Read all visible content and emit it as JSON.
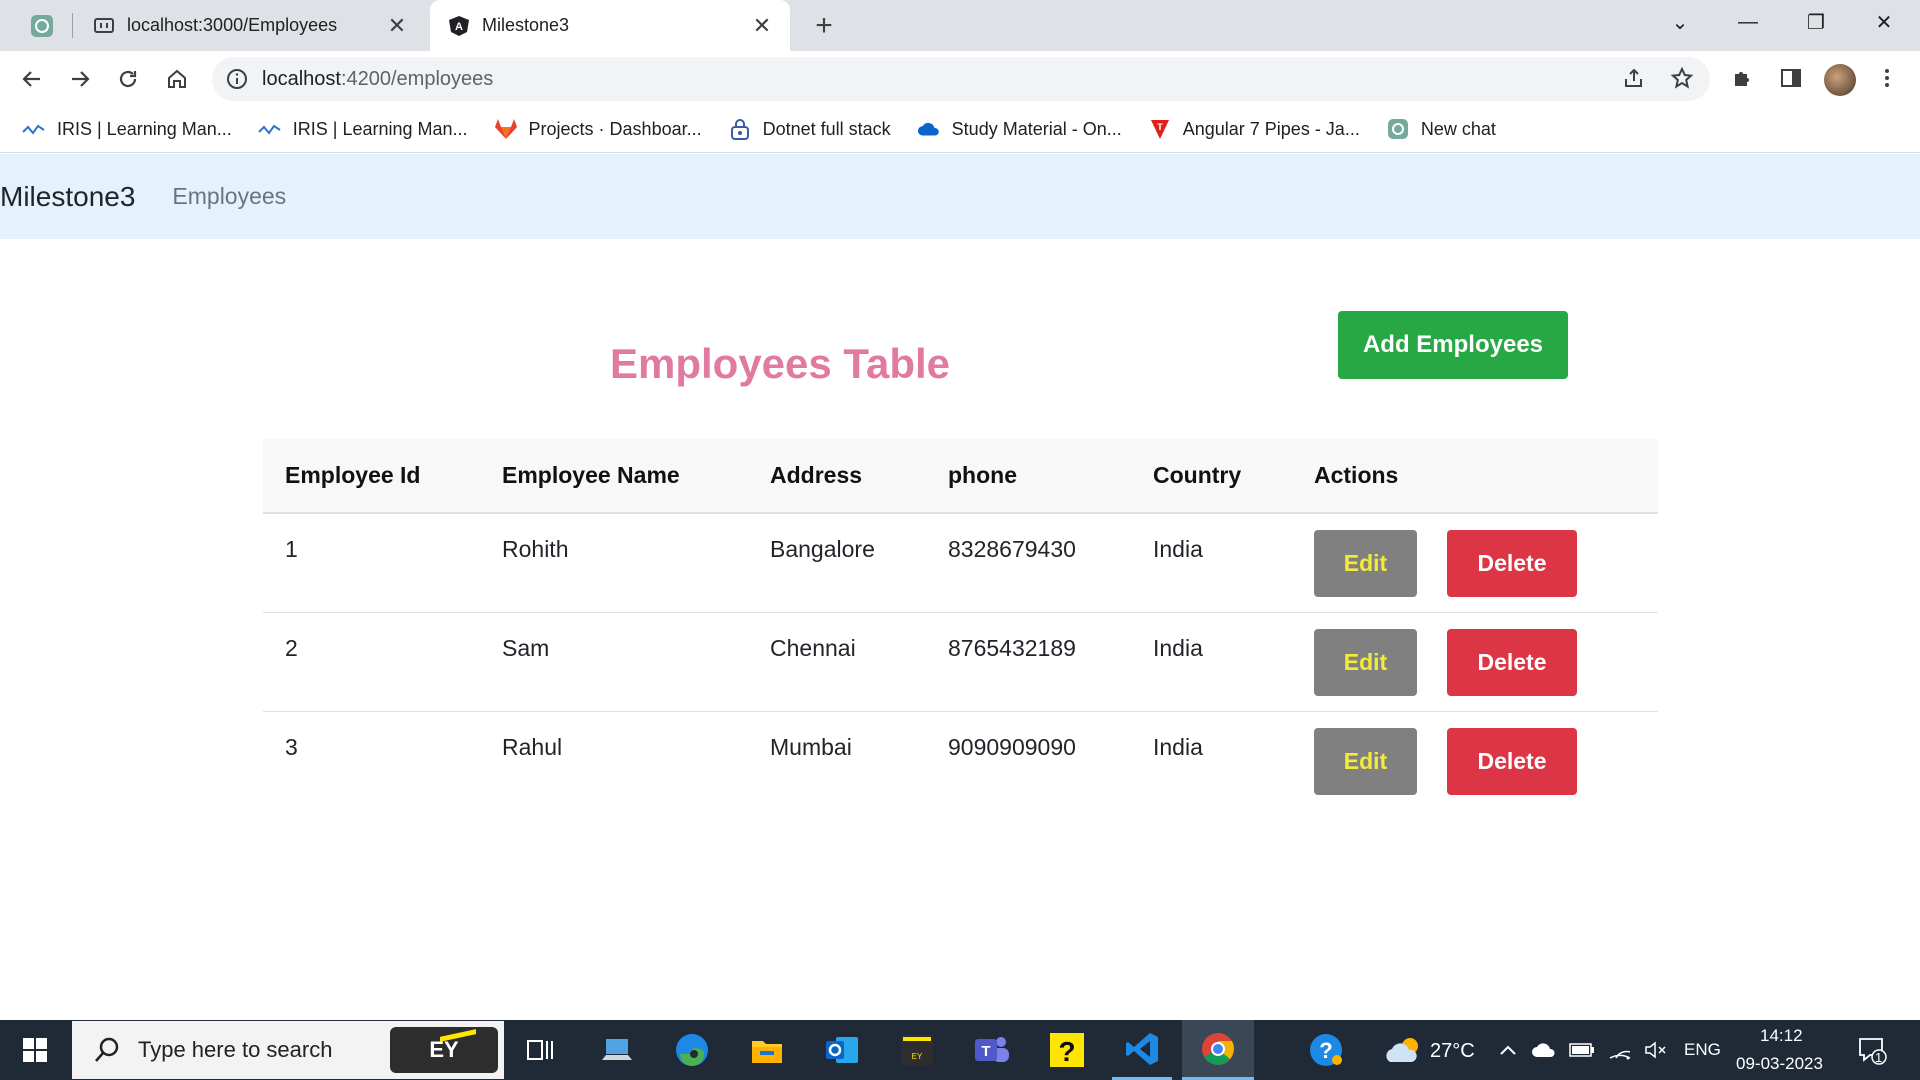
{
  "browser": {
    "tabs": [
      {
        "title": "localhost:3000/Employees",
        "active": false
      },
      {
        "title": "Milestone3",
        "active": true
      }
    ],
    "url_host": "localhost",
    "url_rest": ":4200/employees",
    "bookmarks": [
      {
        "label": "IRIS | Learning Man...",
        "icon": "iris-icon"
      },
      {
        "label": "IRIS | Learning Man...",
        "icon": "iris-icon"
      },
      {
        "label": "Projects · Dashboar...",
        "icon": "gitlab-icon"
      },
      {
        "label": "Dotnet full stack",
        "icon": "lock-icon"
      },
      {
        "label": "Study Material - On...",
        "icon": "onedrive-icon"
      },
      {
        "label": "Angular 7 Pipes - Ja...",
        "icon": "angular-pipes-icon"
      },
      {
        "label": "New chat",
        "icon": "openai-icon"
      }
    ]
  },
  "app": {
    "brand": "Milestone3",
    "nav_link": "Employees",
    "page_title": "Employees Table",
    "add_button": "Add Employees",
    "table": {
      "headers": [
        "Employee Id",
        "Employee Name",
        "Address",
        "phone",
        "Country",
        "Actions"
      ],
      "rows": [
        {
          "id": "1",
          "name": "Rohith",
          "address": "Bangalore",
          "phone": "8328679430",
          "country": "India"
        },
        {
          "id": "2",
          "name": "Sam",
          "address": "Chennai",
          "phone": "8765432189",
          "country": "India"
        },
        {
          "id": "3",
          "name": "Rahul",
          "address": "Mumbai",
          "phone": "9090909090",
          "country": "India"
        }
      ],
      "edit_label": "Edit",
      "delete_label": "Delete"
    }
  },
  "taskbar": {
    "search_placeholder": "Type here to search",
    "ey_label": "EY",
    "temperature": "27°C",
    "language": "ENG",
    "time": "14:12",
    "date": "09-03-2023",
    "notification_count": "1"
  },
  "colors": {
    "title_pink": "#e07aa0",
    "add_green": "#28a745",
    "edit_gray": "#808080",
    "edit_text_yellow": "#f3ea3a",
    "delete_red": "#dc3545",
    "navbar_bg": "#e3f2fd"
  }
}
